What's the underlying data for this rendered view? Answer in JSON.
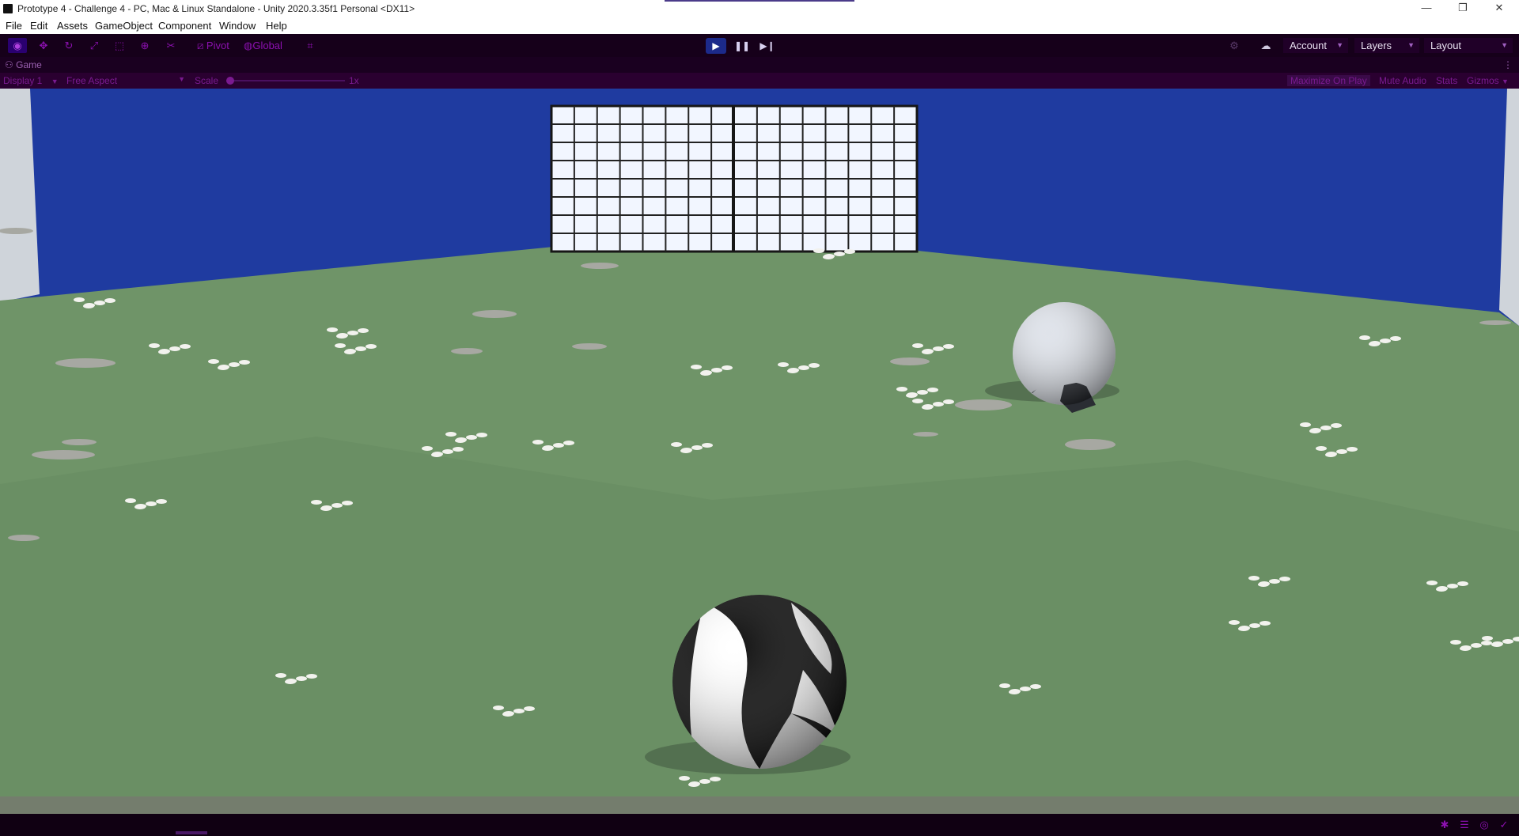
{
  "window": {
    "title": "Prototype 4 - Challenge 4 - PC, Mac & Linux Standalone - Unity 2020.3.35f1 Personal <DX11>",
    "controls": {
      "minimize": "—",
      "restore": "❐",
      "close": "✕"
    }
  },
  "menu": [
    "File",
    "Edit",
    "Assets",
    "GameObject",
    "Component",
    "Window",
    "Help"
  ],
  "toolbar": {
    "tools": [
      "view-tool-icon",
      "move-tool-icon",
      "rotate-tool-icon",
      "scale-tool-icon",
      "rect-tool-icon",
      "transform-tool-icon",
      "custom-tool-icon"
    ],
    "pivot_label": "Pivot",
    "global_label": "Global",
    "play": {
      "play_icon": "▶",
      "pause_icon": "❚❚",
      "step_icon": "▶❙"
    },
    "account_label": "Account",
    "layers_label": "Layers",
    "layout_label": "Layout"
  },
  "game_tab": {
    "label": "Game",
    "menu_icon": "⋮"
  },
  "game_toolbar": {
    "display": "Display 1",
    "aspect": "Free Aspect",
    "scale_label": "Scale",
    "scale_value": "1x",
    "scale_fraction": 0.0,
    "maximize_on_play": "Maximize On Play",
    "mute_audio": "Mute Audio",
    "stats": "Stats",
    "gizmos": "Gizmos"
  },
  "scene": {
    "sky_color": "#1f3ba0",
    "ground_color": "#6f9468",
    "goal_color": "#f2f6ff",
    "ball_colors": [
      "#111111",
      "#ffffff"
    ]
  },
  "status_icons": [
    "bug-icon",
    "layers-icon",
    "target-icon",
    "check-circle-icon"
  ]
}
